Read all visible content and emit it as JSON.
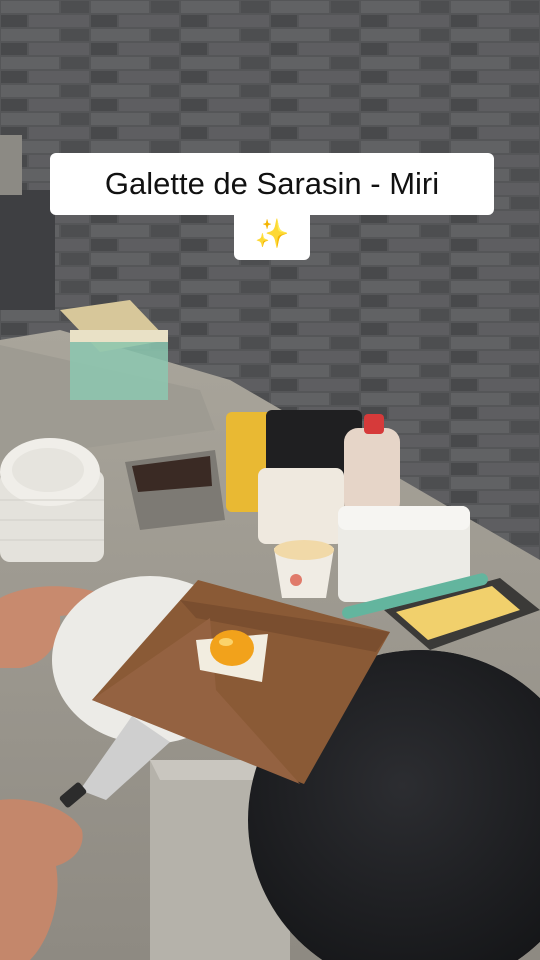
{
  "caption": {
    "line1": "Galette de Sarasin - Miri",
    "line2": "✨"
  },
  "colors": {
    "wall": "#5f6062",
    "counter": "#b9b6ae",
    "galette": "#8a5a36",
    "yolk": "#f2a21b",
    "griddle": "#1c1d20",
    "caption_bg": "#ffffff"
  }
}
